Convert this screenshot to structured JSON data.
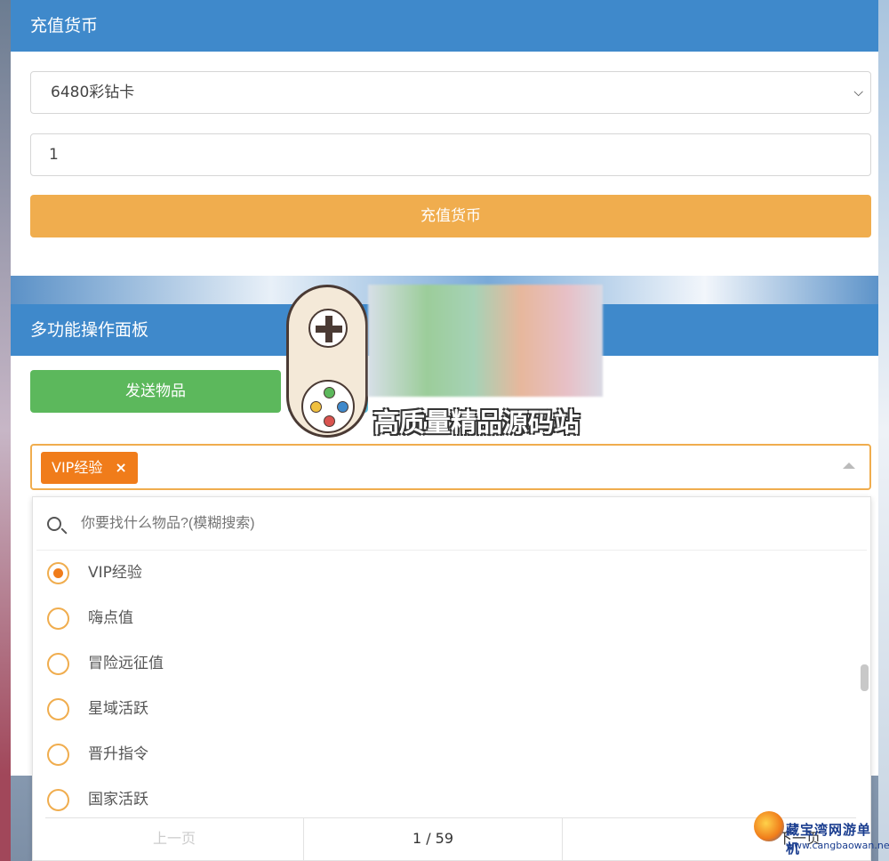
{
  "recharge_panel": {
    "title": "充值货币",
    "selected_currency": "6480彩钻卡",
    "quantity_value": "1",
    "submit_label": "充值货币"
  },
  "multi_panel": {
    "title": "多功能操作面板",
    "send_item_label": "发送物品",
    "selected_tag": "VIP经验",
    "tag_remove": "×",
    "search_placeholder": "你要找什么物品?(模糊搜索)",
    "options": [
      {
        "label": "VIP经验",
        "selected": true
      },
      {
        "label": "嗨点值",
        "selected": false
      },
      {
        "label": "冒险远征值",
        "selected": false
      },
      {
        "label": "星域活跃",
        "selected": false
      },
      {
        "label": "晋升指令",
        "selected": false
      },
      {
        "label": "国家活跃",
        "selected": false
      }
    ],
    "pager": {
      "prev": "上一页",
      "page_info": "1 / 59",
      "next": "下一页"
    }
  },
  "overlay": {
    "caption": "高质量精品源码站"
  },
  "watermark": {
    "title": "藏宝湾网游单机",
    "url": "www.cangbaowan.net"
  },
  "colors": {
    "header_blue": "#3f89cb",
    "primary_orange": "#f0ad4e",
    "tag_orange": "#f07c1a",
    "success_green": "#5cb85c"
  },
  "icons": [
    "chevron-down-icon",
    "search-icon",
    "close-icon",
    "caret-up-icon",
    "radio-icon"
  ]
}
